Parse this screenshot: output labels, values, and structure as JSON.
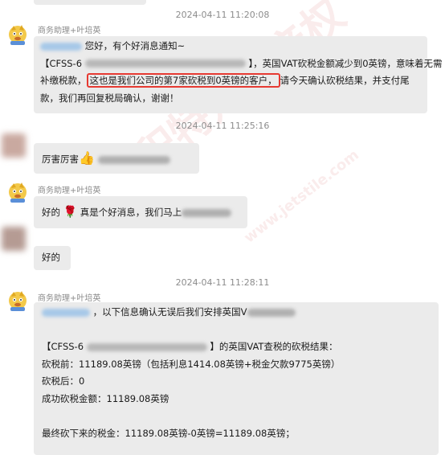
{
  "conversation": {
    "timestamps": [
      "2024-04-11 11:20:08",
      "2024-04-11 11:25:16",
      "2024-04-11 11:28:11"
    ],
    "sender_name": "商务助理+叶培英",
    "msg1": {
      "line1": "您好，有个好消息通知~",
      "line2a": "【CFSS-6",
      "line2b": "】，英国VAT砍税金额减少到0英镑，意味着无需",
      "line3a": "补缴税款，",
      "line3highlight": "这也是我们公司的第7家砍税到0英镑的客户，",
      "line3b": "请今天确认砍税结果，并支付尾",
      "line4": "款，我们再回复税局确认，谢谢！"
    },
    "msg2": {
      "text": "厉害厉害",
      "emoji": "👍"
    },
    "msg3": {
      "start": "好的",
      "rose": "🌹",
      "middle": "真是个好消息，我们马上"
    },
    "msg4": {
      "text": "好的"
    },
    "msg5": {
      "line1": "，以下信息确认无误后我们安排英国V",
      "line2a": "【CFSS-6",
      "line2b": "】的英国VAT查税的砍税结果：",
      "line3": "砍税前：11189.08英镑（包括利息1414.08英镑+税金欠款9775英镑）",
      "line4": "砍税后：0",
      "line5": "成功砍税金额：11189.08英镑",
      "line6": "最终砍下来的税金：11189.08英镑-0英镑=11189.08英镑；"
    }
  },
  "watermark": {
    "text1": "积特知识产权",
    "text2": "www.jetstile.com"
  },
  "colors": {
    "bubble": "#ebebeb",
    "highlight_border": "#e63a32",
    "timestamp": "#8c8c8c"
  }
}
